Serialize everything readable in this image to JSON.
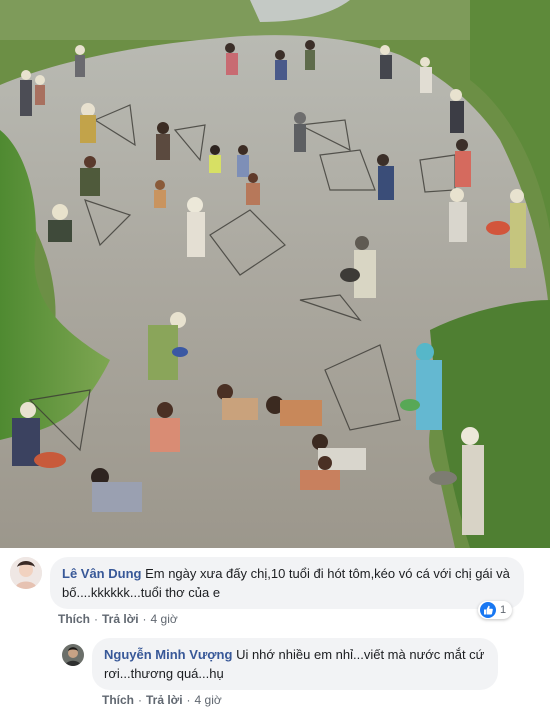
{
  "comments": [
    {
      "author": "Lê Vân Dung",
      "text": "Em ngày xưa đấy chị,10 tuổi đi hót tôm,kéo vó cá với chị gái và bố....kkkkkk...tuổi thơ của e",
      "actions": {
        "like": "Thích",
        "reply": "Trả lời",
        "time": "4 giờ"
      },
      "reaction_count": "1"
    },
    {
      "author": "Nguyễn Minh Vượng",
      "text": "Ui nhớ nhiều em nhỉ...viết mà nước mắt cứ rơi...thương quá...hụ",
      "actions": {
        "like": "Thích",
        "reply": "Trả lời",
        "time": "4 giờ"
      }
    }
  ],
  "colors": {
    "author": "#385898",
    "bubble": "#f2f3f5",
    "like_badge": "#1877f2",
    "water": "#a9a9a3",
    "grass": "#5f8f3a"
  },
  "icons": [
    "like-icon"
  ]
}
